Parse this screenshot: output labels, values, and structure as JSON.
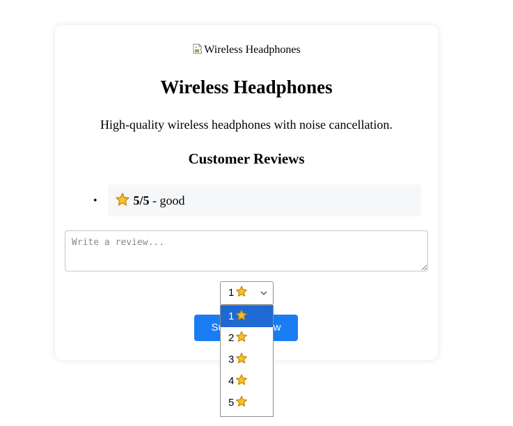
{
  "product": {
    "image_alt": "Wireless Headphones",
    "title": "Wireless Headphones",
    "description": "High-quality wireless headphones with noise cancellation."
  },
  "reviews": {
    "heading": "Customer Reviews",
    "items": [
      {
        "rating_text": "5/5",
        "separator": " - ",
        "comment": "good",
        "icon": "star-icon"
      }
    ]
  },
  "form": {
    "review_placeholder": "Write a review...",
    "review_value": "",
    "rating_select": {
      "selected_value": "1",
      "options": [
        "1",
        "2",
        "3",
        "4",
        "5"
      ],
      "open": true,
      "highlighted_index": 0
    },
    "submit_label": "Submit Review"
  },
  "colors": {
    "accent_button": "#1a7cf2",
    "dropdown_highlight": "#1e69d2",
    "review_item_bg": "#f6f7f9",
    "star_fill": "#f5c12e",
    "star_outline": "#c8830a"
  }
}
